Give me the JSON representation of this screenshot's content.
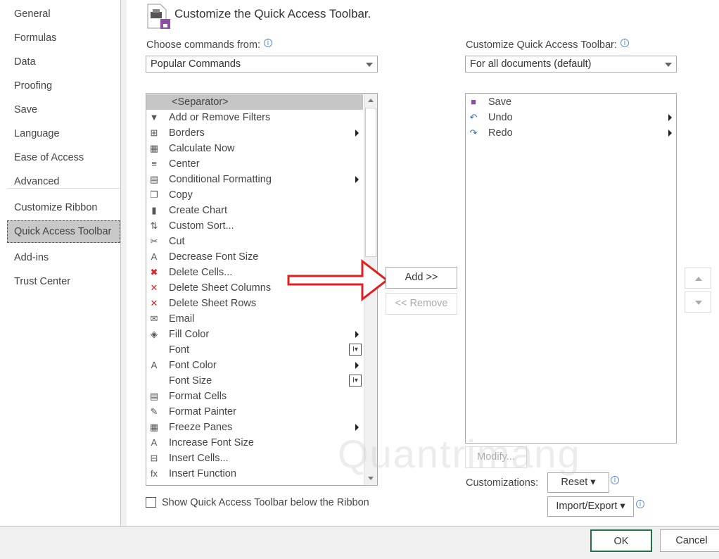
{
  "sidebar": {
    "items": [
      "General",
      "Formulas",
      "Data",
      "Proofing",
      "Save",
      "Language",
      "Ease of Access",
      "Advanced",
      "Customize Ribbon",
      "Quick Access Toolbar",
      "Add-ins",
      "Trust Center"
    ],
    "selected": "Quick Access Toolbar"
  },
  "header": {
    "title": "Customize the Quick Access Toolbar."
  },
  "left": {
    "label": "Choose commands from:",
    "value": "Popular Commands",
    "commands": [
      {
        "label": "<Separator>",
        "icon": "separator",
        "sel": true
      },
      {
        "label": "Add or Remove Filters",
        "icon": "funnel"
      },
      {
        "label": "Borders",
        "icon": "borders",
        "sub": true
      },
      {
        "label": "Calculate Now",
        "icon": "calculator"
      },
      {
        "label": "Center",
        "icon": "center-align"
      },
      {
        "label": "Conditional Formatting",
        "icon": "conditional-formatting",
        "sub": true
      },
      {
        "label": "Copy",
        "icon": "copy"
      },
      {
        "label": "Create Chart",
        "icon": "chart"
      },
      {
        "label": "Custom Sort...",
        "icon": "sort"
      },
      {
        "label": "Cut",
        "icon": "scissors"
      },
      {
        "label": "Decrease Font Size",
        "icon": "font-decrease"
      },
      {
        "label": "Delete Cells...",
        "icon": "delete-cells"
      },
      {
        "label": "Delete Sheet Columns",
        "icon": "delete-columns"
      },
      {
        "label": "Delete Sheet Rows",
        "icon": "delete-rows"
      },
      {
        "label": "Email",
        "icon": "email"
      },
      {
        "label": "Fill Color",
        "icon": "fill-bucket",
        "sub": true
      },
      {
        "label": "Font",
        "icon": "font",
        "fp": true
      },
      {
        "label": "Font Color",
        "icon": "font-color",
        "sub": true
      },
      {
        "label": "Font Size",
        "icon": "font-size",
        "fp": true
      },
      {
        "label": "Format Cells",
        "icon": "format-cells"
      },
      {
        "label": "Format Painter",
        "icon": "paintbrush"
      },
      {
        "label": "Freeze Panes",
        "icon": "freeze-panes",
        "sub": true
      },
      {
        "label": "Increase Font Size",
        "icon": "font-increase"
      },
      {
        "label": "Insert Cells...",
        "icon": "insert-cells"
      },
      {
        "label": "Insert Function",
        "icon": "fx"
      }
    ],
    "checkbox": "Show Quick Access Toolbar below the Ribbon"
  },
  "right": {
    "label": "Customize Quick Access Toolbar:",
    "value": "For all documents (default)",
    "items": [
      {
        "label": "Save",
        "icon": "save"
      },
      {
        "label": "Undo",
        "icon": "undo",
        "sub": true
      },
      {
        "label": "Redo",
        "icon": "redo",
        "sub": true
      }
    ],
    "modify": "Modify...",
    "customizations": "Customizations:",
    "reset": "Reset",
    "import_export": "Import/Export"
  },
  "buttons": {
    "add": "Add >>",
    "remove": "<< Remove",
    "ok": "OK",
    "cancel": "Cancel"
  },
  "watermark": "Quantrimang",
  "colors": {
    "accent": "#217346",
    "arrow": "#e02020"
  }
}
